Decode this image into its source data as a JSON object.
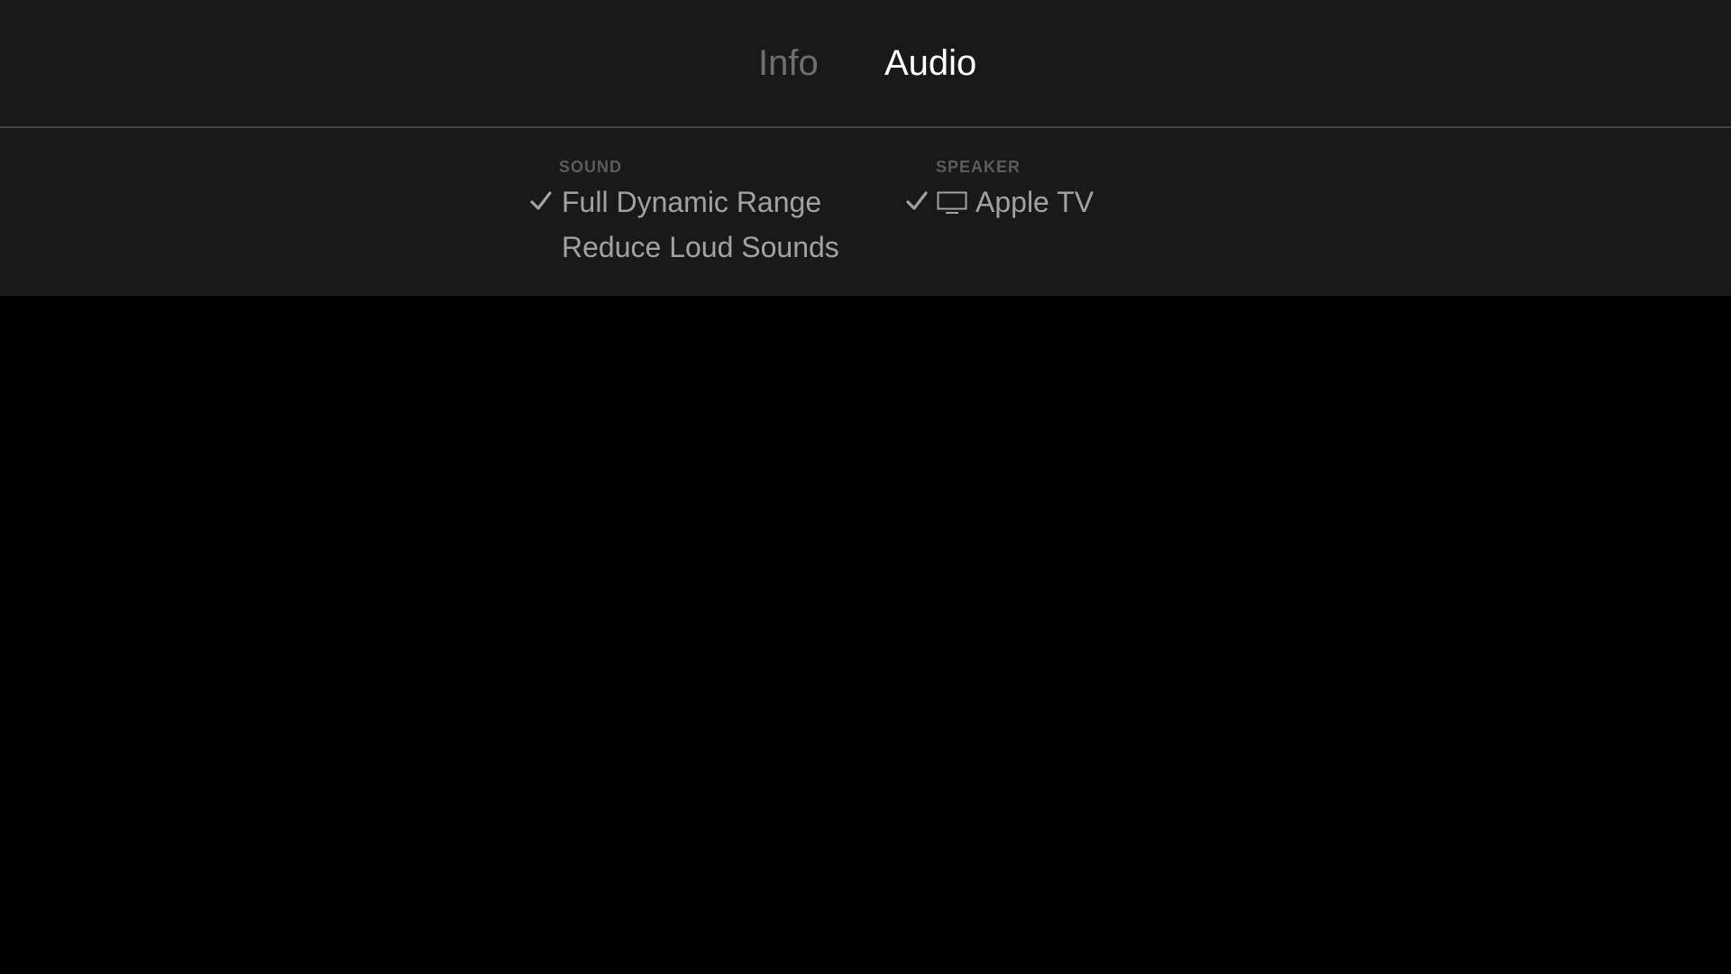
{
  "tabs": [
    {
      "label": "Info",
      "selected": false
    },
    {
      "label": "Audio",
      "selected": true
    }
  ],
  "sound": {
    "header": "SOUND",
    "options": [
      {
        "label": "Full Dynamic Range",
        "checked": true
      },
      {
        "label": "Reduce Loud Sounds",
        "checked": false
      }
    ]
  },
  "speaker": {
    "header": "SPEAKER",
    "options": [
      {
        "label": "Apple TV",
        "checked": true,
        "icon": "tv-icon"
      }
    ]
  },
  "colors": {
    "panel_background": "#19191b",
    "screen_background": "#000000",
    "tab_selected": "#ffffff",
    "tab_unselected": "#6f6f73",
    "option_text": "#a2a2a6",
    "section_header": "#5c5c60",
    "divider": "#47474a"
  }
}
